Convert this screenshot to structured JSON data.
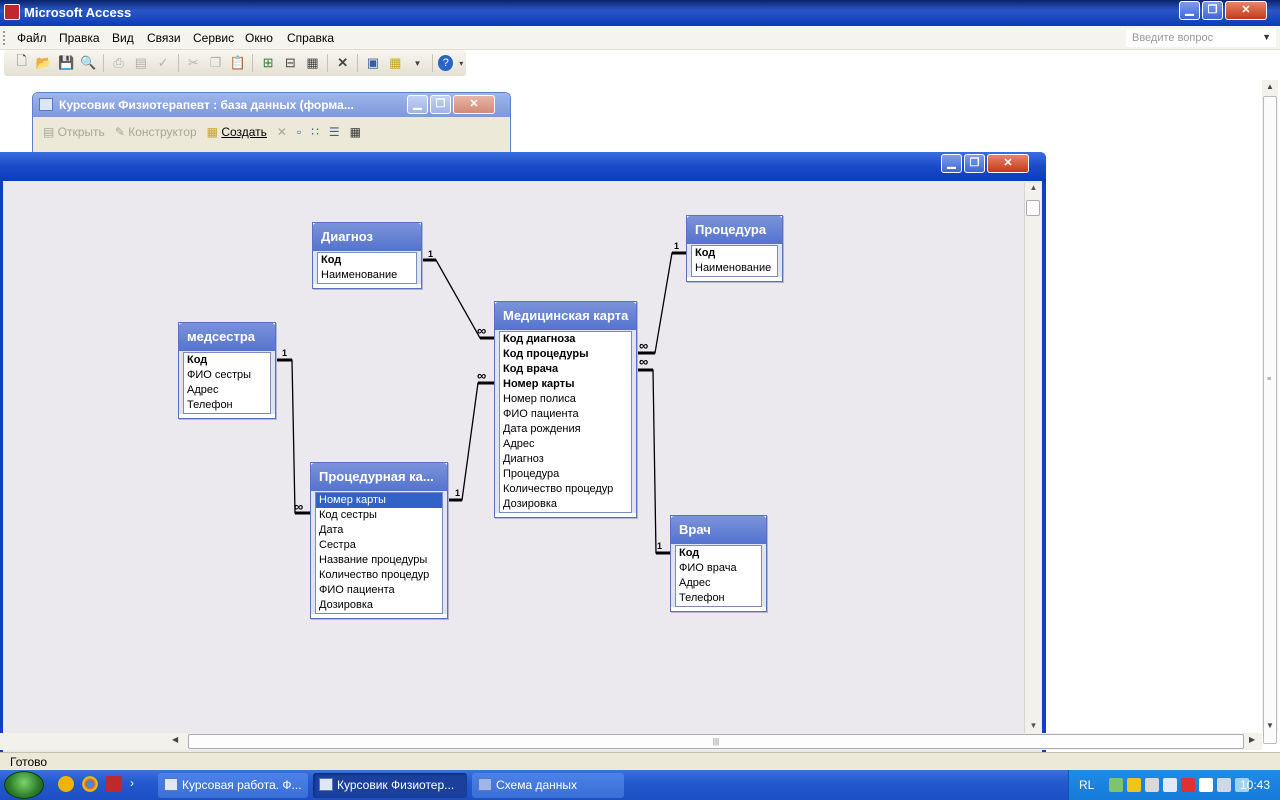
{
  "app": {
    "title": "Microsoft Access",
    "min_glyph": "▁",
    "max_glyph": "❐",
    "close_glyph": "✕"
  },
  "menu": {
    "items": [
      "Файл",
      "Правка",
      "Вид",
      "Связи",
      "Сервис",
      "Окно",
      "Справка"
    ],
    "ask_placeholder": "Введите вопрос"
  },
  "toolbar_icons": [
    "new-icon",
    "open-icon",
    "save-icon",
    "search-icon",
    "print-icon",
    "print-preview-icon",
    "spelling-icon",
    "cut-icon",
    "copy-icon",
    "paste-icon",
    "show-table-icon",
    "show-direct-icon",
    "show-all-icon",
    "delete-icon",
    "database-window-icon",
    "new-object-icon",
    "help-icon"
  ],
  "db_window": {
    "title": "Курсовик Физиотерапевт : база данных (форма...",
    "open_label": "Открыть",
    "design_label": "Конструктор",
    "create_label": "Создать"
  },
  "tables": {
    "diagnoz": {
      "name": "Диагноз",
      "fields": [
        "Код",
        "Наименование"
      ]
    },
    "procedura": {
      "name": "Процедура",
      "fields": [
        "Код",
        "Наименование"
      ]
    },
    "medsestra": {
      "name": "медсестра",
      "fields": [
        "Код",
        "ФИО сестры",
        "Адрес",
        "Телефон"
      ]
    },
    "medkarta": {
      "name": "Медицинская карта",
      "fields": [
        "Код диагноза",
        "Код процедуры",
        "Код врача",
        "Номер карты",
        "Номер полиса",
        "ФИО пациента",
        "Дата рождения",
        "Адрес",
        "Диагноз",
        "Процедура",
        "Количество процедур",
        "Дозировка"
      ]
    },
    "prockarta": {
      "name": "Процедурная ка...",
      "fields": [
        "Номер карты",
        "Код сестры",
        "Дата",
        "Сестра",
        "Название процедуры",
        "Количество процедур",
        "ФИО пациента",
        "Дозировка"
      ]
    },
    "vrach": {
      "name": "Врач",
      "fields": [
        "Код",
        "ФИО врача",
        "Адрес",
        "Телефон"
      ]
    }
  },
  "relations": {
    "one_label": "1",
    "many_label": "∞"
  },
  "status": {
    "text": "Готово"
  },
  "taskbar": {
    "tasks": [
      "Курсовая работа. Ф...",
      "Курсовик Физиотер...",
      "Схема данных"
    ],
    "more_glyph": "›",
    "lang": "RL",
    "clock": "10:43"
  }
}
